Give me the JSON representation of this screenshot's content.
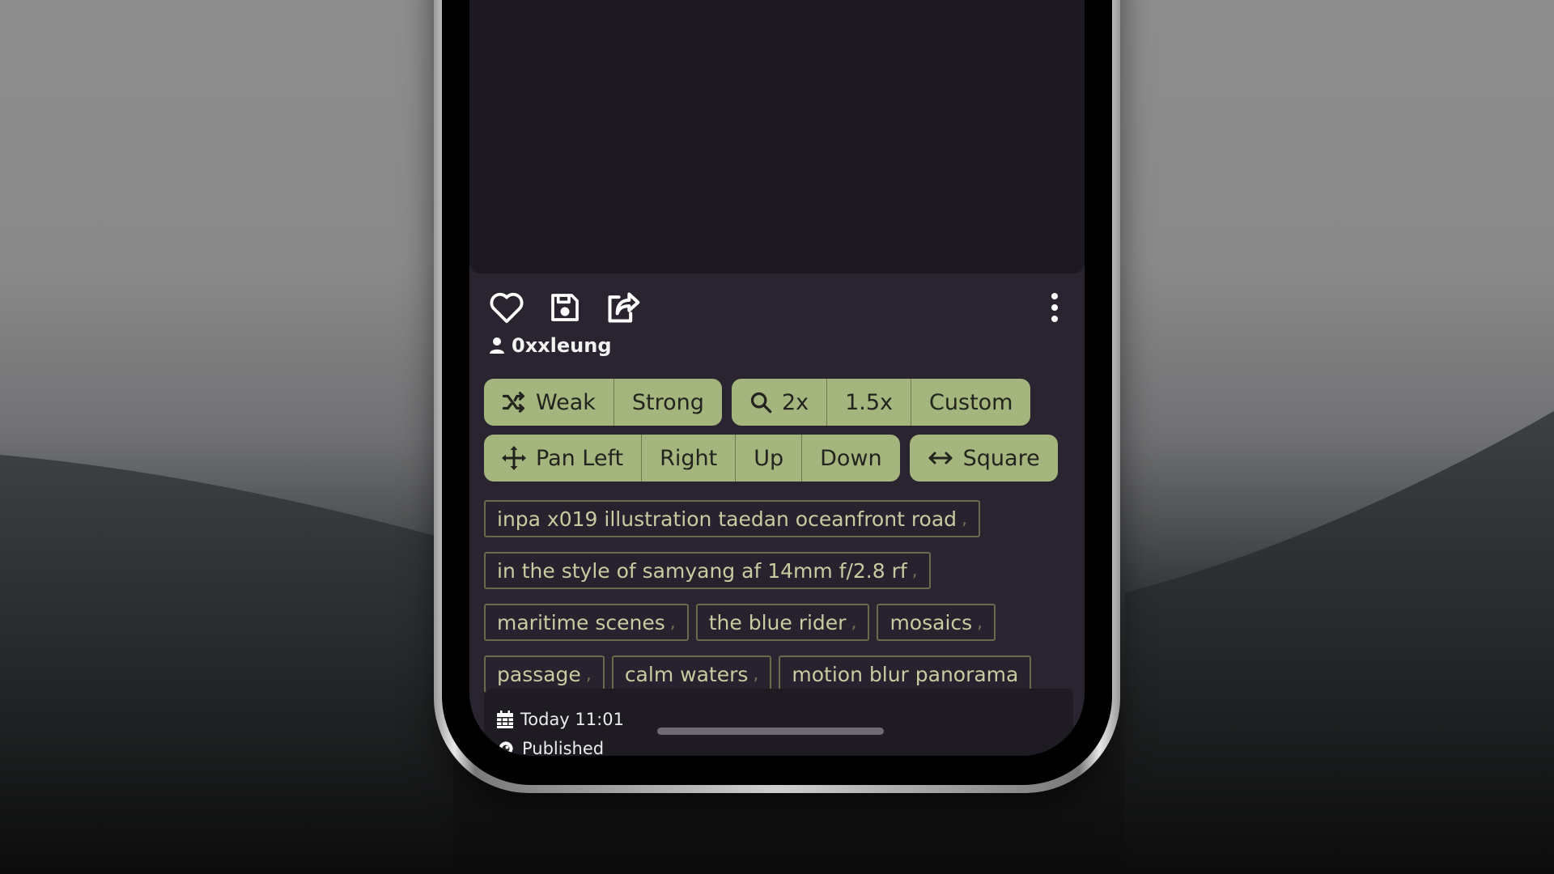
{
  "actions": {
    "like_icon": "heart-icon",
    "save_icon": "floppy-disk-icon",
    "share_icon": "share-icon",
    "more_icon": "more-vertical-icon"
  },
  "author": {
    "icon": "user-icon",
    "name": "0xxleung"
  },
  "variation": {
    "icon": "shuffle-icon",
    "buttons": [
      "Weak",
      "Strong"
    ]
  },
  "zoom": {
    "icon": "search-icon",
    "buttons": [
      "2x",
      "1.5x",
      "Custom"
    ]
  },
  "pan": {
    "icon": "move-icon",
    "buttons": [
      "Pan Left",
      "Right",
      "Up",
      "Down"
    ]
  },
  "aspect": {
    "icon": "arrows-horizontal-icon",
    "label": "Square"
  },
  "prompt_tags": [
    "inpa x019 illustration taedan oceanfront road",
    "in the style of samyang af 14mm f/2.8 rf",
    "maritime scenes",
    "the blue rider",
    "mosaics",
    "passage",
    "calm waters",
    "motion blur panorama"
  ],
  "separator": ",",
  "meta": {
    "date_icon": "calendar-icon",
    "date": "Today 11:01",
    "visibility_icon": "eye-icon",
    "visibility": "Published"
  },
  "colors": {
    "button_bg": "#a4b57d",
    "tag_text": "#c7cca0",
    "screen_bg": "#29242f"
  }
}
